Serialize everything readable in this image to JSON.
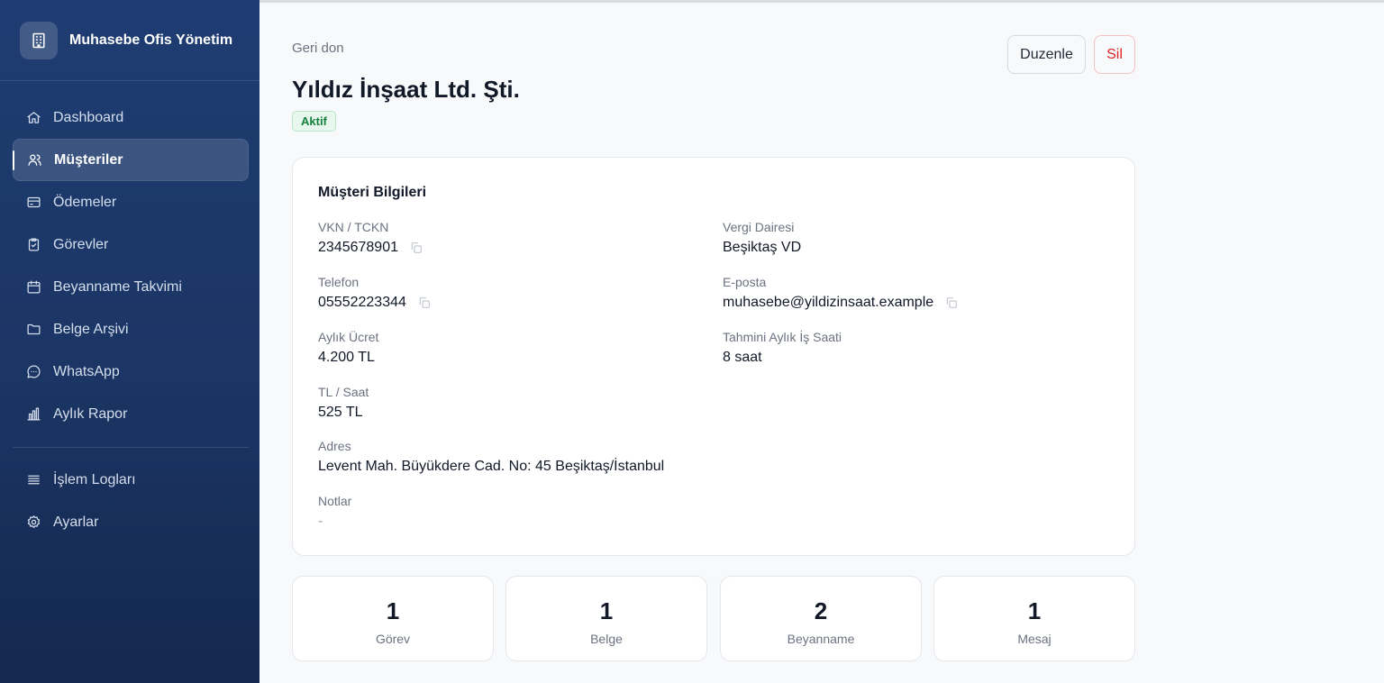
{
  "app": {
    "title": "Muhasebe Ofis Yönetim"
  },
  "sidebar": {
    "items": [
      {
        "label": "Dashboard",
        "icon": "home-icon"
      },
      {
        "label": "Müşteriler",
        "icon": "users-icon",
        "active": true
      },
      {
        "label": "Ödemeler",
        "icon": "credit-card-icon"
      },
      {
        "label": "Görevler",
        "icon": "clipboard-check-icon"
      },
      {
        "label": "Beyanname Takvimi",
        "icon": "calendar-icon"
      },
      {
        "label": "Belge Arşivi",
        "icon": "folder-icon"
      },
      {
        "label": "WhatsApp",
        "icon": "chat-bubble-icon"
      },
      {
        "label": "Aylık Rapor",
        "icon": "bar-chart-icon"
      }
    ],
    "bottom_items": [
      {
        "label": "İşlem Logları",
        "icon": "list-icon"
      },
      {
        "label": "Ayarlar",
        "icon": "gear-icon"
      }
    ]
  },
  "header": {
    "back_label": "Geri don",
    "title": "Yıldız İnşaat Ltd. Şti.",
    "status": "Aktif",
    "edit_label": "Duzenle",
    "delete_label": "Sil"
  },
  "customer": {
    "section_title": "Müşteri Bilgileri",
    "fields": {
      "tax_id": {
        "label": "VKN / TCKN",
        "value": "2345678901"
      },
      "tax_office": {
        "label": "Vergi Dairesi",
        "value": "Beşiktaş VD"
      },
      "phone": {
        "label": "Telefon",
        "value": "05552223344"
      },
      "email": {
        "label": "E-posta",
        "value": "muhasebe@yildizinsaat.example"
      },
      "monthly_fee": {
        "label": "Aylık Ücret",
        "value": "4.200 TL"
      },
      "monthly_hours": {
        "label": "Tahmini Aylık İş Saati",
        "value": "8 saat"
      },
      "hourly_rate": {
        "label": "TL / Saat",
        "value": "525 TL"
      },
      "address": {
        "label": "Adres",
        "value": "Levent Mah. Büyükdere Cad. No: 45 Beşiktaş/İstanbul"
      },
      "notes": {
        "label": "Notlar",
        "value": "-"
      }
    }
  },
  "stats": [
    {
      "value": "1",
      "label": "Görev"
    },
    {
      "value": "1",
      "label": "Belge"
    },
    {
      "value": "2",
      "label": "Beyanname"
    },
    {
      "value": "1",
      "label": "Mesaj"
    }
  ],
  "colors": {
    "sidebar_top": "#1e3d72",
    "sidebar_bottom": "#15284f",
    "status_green": "#15803d",
    "danger_red": "#dc2626"
  }
}
